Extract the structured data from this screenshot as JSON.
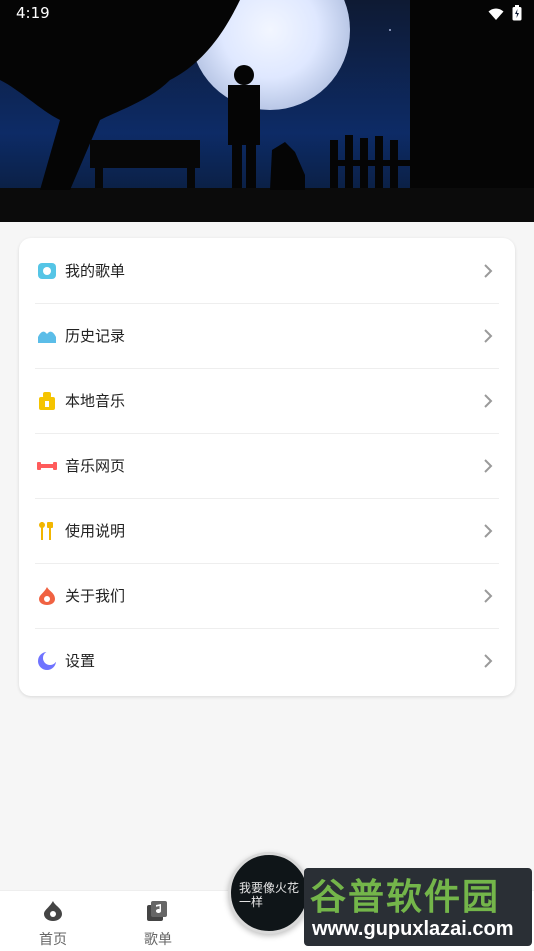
{
  "status_bar": {
    "time": "4:19"
  },
  "header": {
    "image_name": "moonlit-night-silhouette"
  },
  "menu": {
    "items": [
      {
        "label": "我的歌单",
        "icon": "playlist-icon",
        "color": "#55c5e6"
      },
      {
        "label": "历史记录",
        "icon": "history-icon",
        "color": "#5bbde8"
      },
      {
        "label": "本地音乐",
        "icon": "local-music-icon",
        "color": "#f5c400"
      },
      {
        "label": "音乐网页",
        "icon": "music-web-icon",
        "color": "#ff5b5b"
      },
      {
        "label": "使用说明",
        "icon": "instructions-icon",
        "color": "#f2b600"
      },
      {
        "label": "关于我们",
        "icon": "about-icon",
        "color": "#f06242"
      },
      {
        "label": "设置",
        "icon": "settings-icon",
        "color": "#6f73ff"
      }
    ]
  },
  "bottom_nav": {
    "items": [
      {
        "label": "首页",
        "icon": "home-flame-icon"
      },
      {
        "label": "歌单",
        "icon": "playlist-music-icon"
      }
    ]
  },
  "player": {
    "album_text": "我要像火花一样"
  },
  "watermark": {
    "big": "谷普软件园",
    "small": "www.gupuxlazai.com"
  }
}
